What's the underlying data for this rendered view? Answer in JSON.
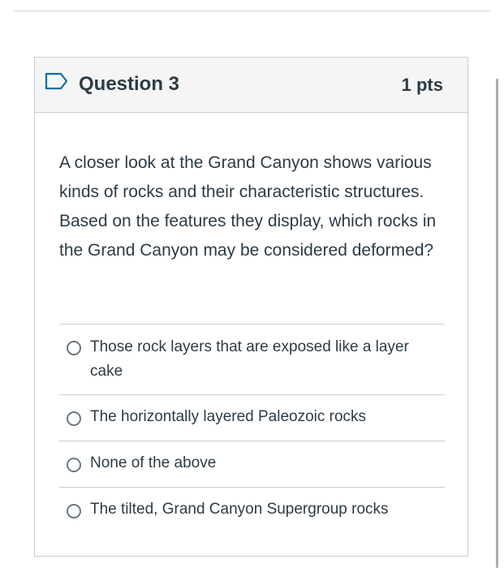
{
  "question": {
    "title": "Question 3",
    "points": "1 pts",
    "text": "A closer look at the Grand Canyon shows various kinds of rocks and their characteristic structures. Based on the features they display, which rocks in the Grand Canyon may be considered deformed?",
    "flag_icon": "flag-outline-icon"
  },
  "answers": [
    {
      "label": "Those rock layers that are exposed like a layer cake"
    },
    {
      "label": "The horizontally layered Paleozoic rocks"
    },
    {
      "label": "None of the above"
    },
    {
      "label": "The tilted, Grand Canyon Supergroup rocks"
    }
  ],
  "colors": {
    "accent": "#0770a3",
    "header_bg": "#f5f5f5",
    "border": "#c7cdd1",
    "text": "#2d3b45"
  }
}
